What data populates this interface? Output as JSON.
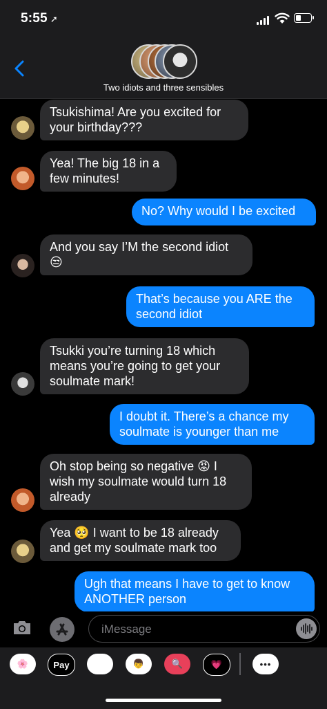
{
  "status_bar": {
    "time": "5:55",
    "location_arrow": "location-arrow-icon"
  },
  "header": {
    "group_name": "Two idiots and three sensibles",
    "back_icon": "chevron-left-icon"
  },
  "messages": [
    {
      "side": "received",
      "text": "Tsukishima! Are you excited for your birthday???"
    },
    {
      "side": "received",
      "text": "Yea! The big 18 in a few minutes!"
    },
    {
      "side": "sent",
      "text": "No? Why would I be excited"
    },
    {
      "side": "received",
      "text": "And you say I’M the second idiot 😒"
    },
    {
      "side": "sent",
      "text": "That’s because you ARE the second idiot"
    },
    {
      "side": "received",
      "text": "Tsukki you’re turning 18 which means you’re going to get your soulmate mark!"
    },
    {
      "side": "sent",
      "text": "I doubt it. There’s a chance my soulmate is younger than me"
    },
    {
      "side": "received",
      "text": "Oh stop being so negative 😡 I wish my soulmate would turn 18 already"
    },
    {
      "side": "received",
      "text": "Yea 🥺 I want to be 18 already and get my soulmate mark too"
    },
    {
      "side": "sent",
      "text": "Ugh that means I have to get to know ANOTHER person"
    }
  ],
  "input": {
    "placeholder": "iMessage"
  },
  "app_drawer": [
    {
      "name": "photos",
      "label": "🌸"
    },
    {
      "name": "apple-pay",
      "label": "Pay"
    },
    {
      "name": "animoji",
      "label": "🐵"
    },
    {
      "name": "memoji",
      "label": "👦"
    },
    {
      "name": "image-search",
      "label": "🔍"
    },
    {
      "name": "digital-touch",
      "label": "💗"
    },
    {
      "name": "more",
      "label": "•••"
    }
  ],
  "colors": {
    "sent_bubble": "#0b84fe",
    "received_bubble": "#2c2c2e",
    "accent": "#0a84ff"
  }
}
